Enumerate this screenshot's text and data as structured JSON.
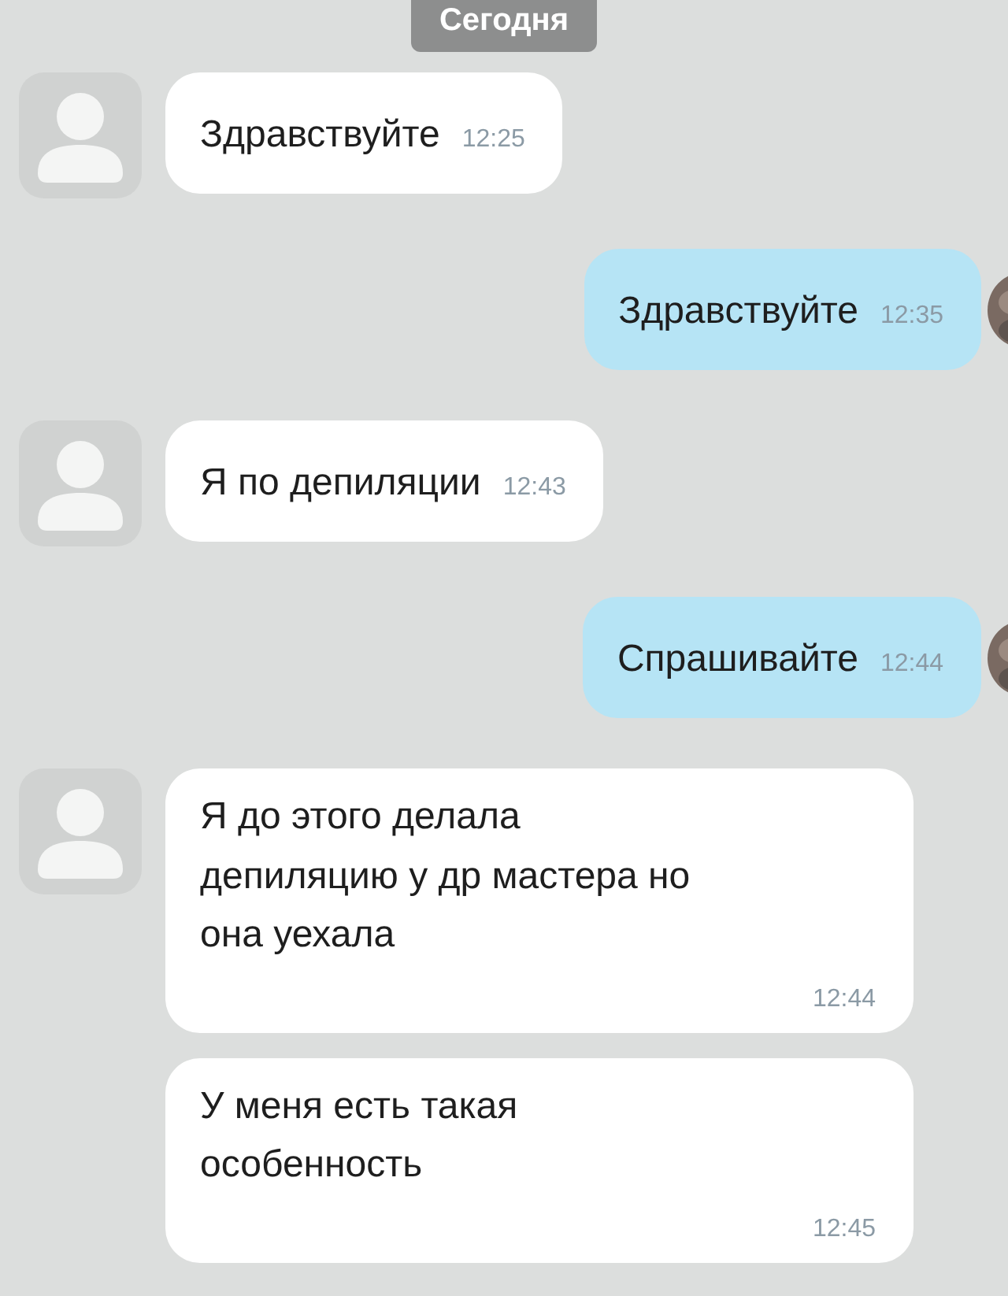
{
  "date_label": "Сегодня",
  "messages": [
    {
      "kind": "incoming",
      "show_avatar": true,
      "text": "Здравствуйте",
      "time": "12:25"
    },
    {
      "kind": "outgoing",
      "show_avatar": true,
      "text": "Здравствуйте",
      "time": "12:35"
    },
    {
      "kind": "incoming",
      "show_avatar": true,
      "text": "Я по депиляции",
      "time": "12:43"
    },
    {
      "kind": "outgoing",
      "show_avatar": true,
      "text": "Спрашивайте",
      "time": "12:44"
    },
    {
      "kind": "incoming_stacked",
      "show_avatar": true,
      "text": "Я до этого делала\nдепиляцию у др мастера но\nона уехала",
      "time": "12:44"
    },
    {
      "kind": "incoming_stacked",
      "show_avatar": false,
      "text": "У меня есть такая\nособенность",
      "time": "12:45"
    }
  ]
}
